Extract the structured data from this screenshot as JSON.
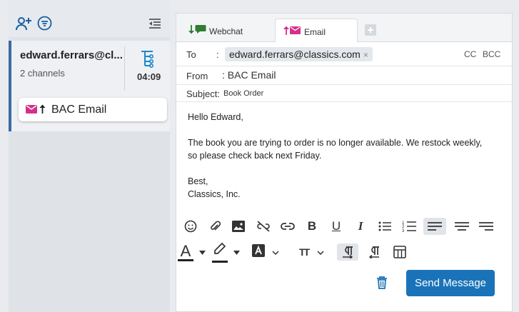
{
  "sidebar": {
    "conversation": {
      "email": "edward.ferrars@cl...",
      "channels": "2 channels",
      "time": "04:09",
      "channel_label": "BAC Email"
    }
  },
  "tabs": [
    {
      "label": "Webchat"
    },
    {
      "label": "Email"
    }
  ],
  "compose": {
    "to_label": "To",
    "to_sep": ":",
    "to_value": "edward.ferrars@classics.com",
    "chip_remove": "×",
    "cc": "CC",
    "bcc": "BCC",
    "from_label": "From",
    "from_value": ": BAC Email",
    "subject_label": "Subject:",
    "subject_value": "Book Order",
    "body": [
      "Hello Edward,",
      "",
      "The book you are trying to order is no longer available. We restock weekly,",
      "so please check back next Friday.",
      "",
      "Best,",
      "Classics, Inc."
    ]
  },
  "toolbar": {
    "bold": "B",
    "italic": "I",
    "underline": "U",
    "font_color": "A",
    "text_size": "TT"
  },
  "send_label": "Send Message",
  "colors": {
    "accent": "#1a73b8",
    "email_pink": "#d6308a",
    "webchat_green": "#2e7d32",
    "sidebar_bar": "#3b6aa0"
  }
}
